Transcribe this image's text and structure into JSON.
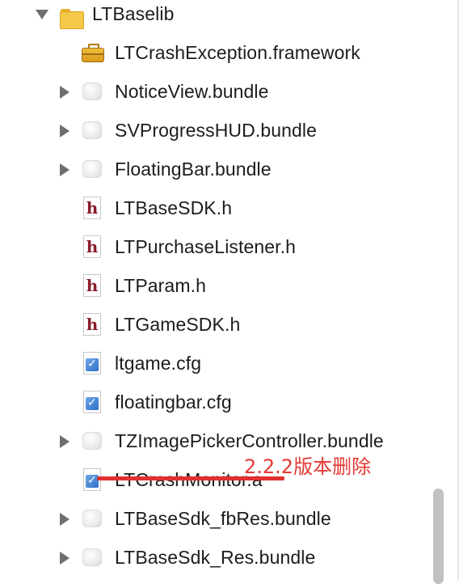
{
  "navigator": {
    "rows": [
      {
        "label": "LTBaselib",
        "icon": "folder-icon",
        "disclosure": "open"
      },
      {
        "label": "LTCrashException.framework",
        "icon": "framework-icon",
        "disclosure": "none"
      },
      {
        "label": "NoticeView.bundle",
        "icon": "bundle-icon",
        "disclosure": "closed"
      },
      {
        "label": "SVProgressHUD.bundle",
        "icon": "bundle-icon",
        "disclosure": "closed"
      },
      {
        "label": "FloatingBar.bundle",
        "icon": "bundle-icon",
        "disclosure": "closed"
      },
      {
        "label": "LTBaseSDK.h",
        "icon": "header-file-icon",
        "disclosure": "none"
      },
      {
        "label": "LTPurchaseListener.h",
        "icon": "header-file-icon",
        "disclosure": "none"
      },
      {
        "label": "LTParam.h",
        "icon": "header-file-icon",
        "disclosure": "none"
      },
      {
        "label": "LTGameSDK.h",
        "icon": "header-file-icon",
        "disclosure": "none"
      },
      {
        "label": "ltgame.cfg",
        "icon": "cfg-file-icon",
        "disclosure": "none"
      },
      {
        "label": "floatingbar.cfg",
        "icon": "cfg-file-icon",
        "disclosure": "none"
      },
      {
        "label": "TZImagePickerController.bundle",
        "icon": "bundle-icon",
        "disclosure": "closed"
      },
      {
        "label": "LTCrashMonitor.a",
        "icon": "cfg-file-icon",
        "disclosure": "none"
      },
      {
        "label": "LTBaseSdk_fbRes.bundle",
        "icon": "bundle-icon",
        "disclosure": "closed"
      },
      {
        "label": "LTBaseSdk_Res.bundle",
        "icon": "bundle-icon",
        "disclosure": "closed"
      }
    ],
    "header_glyph": "h",
    "cfg_glyph": "✓"
  },
  "annotation": {
    "text": "2.2.2版本删除",
    "color": "#e53935"
  },
  "colors": {
    "folder": "#f5c847",
    "header_glyph": "#8a1c2b",
    "cfg_badge": "#2f6fc8",
    "strike": "#e03030"
  }
}
